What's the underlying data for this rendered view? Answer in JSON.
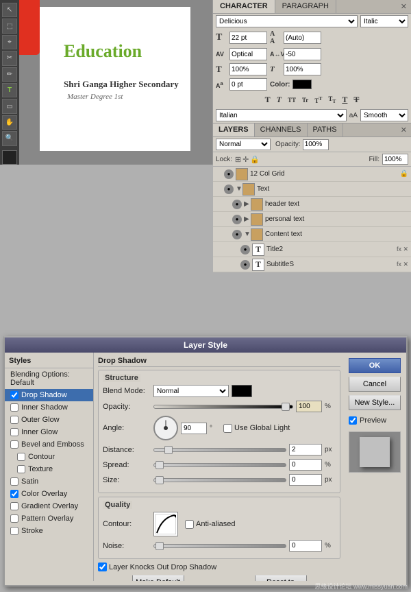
{
  "app": {
    "title": "Layer Style"
  },
  "character_panel": {
    "tabs": [
      "CHARACTER",
      "PARAGRAPH"
    ],
    "active_tab": "CHARACTER",
    "font_family": "Delicious",
    "font_style": "Italic",
    "font_size": "22 pt",
    "leading": "(Auto)",
    "kerning": "Optical",
    "tracking": "-50",
    "scale_v": "100%",
    "scale_h": "100%",
    "baseline": "0 pt",
    "color_label": "Color:",
    "language": "Italian",
    "anti_alias": "Smooth"
  },
  "layers_panel": {
    "tabs": [
      "LAYERS",
      "CHANNELS",
      "PATHS"
    ],
    "active_tab": "LAYERS",
    "blend_mode": "Normal",
    "opacity_label": "Opacity:",
    "opacity_value": "100%",
    "lock_label": "Lock:",
    "fill_label": "Fill:",
    "fill_value": "100%",
    "layers": [
      {
        "id": "grid",
        "name": "12 Col Grid",
        "type": "group",
        "indent": 1,
        "visible": true,
        "locked": true
      },
      {
        "id": "text",
        "name": "Text",
        "type": "group",
        "indent": 1,
        "visible": true
      },
      {
        "id": "header",
        "name": "header text",
        "type": "group",
        "indent": 2,
        "visible": true
      },
      {
        "id": "personal",
        "name": "personal text",
        "type": "group",
        "indent": 2,
        "visible": true
      },
      {
        "id": "content",
        "name": "Content text",
        "type": "group",
        "indent": 2,
        "visible": true
      },
      {
        "id": "title2",
        "name": "Title2",
        "type": "text",
        "indent": 3,
        "visible": true,
        "has_fx": true
      },
      {
        "id": "subtitle5",
        "name": "SubtitleS",
        "type": "text",
        "indent": 3,
        "visible": true,
        "has_fx": true
      }
    ]
  },
  "canvas": {
    "education_text": "Education",
    "school_text": "Shri Ganga Higher Secondary",
    "degree_text": "Master Degree 1st"
  },
  "layer_style_dialog": {
    "title": "Layer Style",
    "styles_header": "Styles",
    "styles": [
      {
        "id": "blending",
        "label": "Blending Options: Default",
        "type": "item"
      },
      {
        "id": "drop_shadow",
        "label": "Drop Shadow",
        "type": "checkbox",
        "checked": true,
        "selected": true
      },
      {
        "id": "inner_shadow",
        "label": "Inner Shadow",
        "type": "checkbox",
        "checked": false
      },
      {
        "id": "outer_glow",
        "label": "Outer Glow",
        "type": "checkbox",
        "checked": false
      },
      {
        "id": "inner_glow",
        "label": "Inner Glow",
        "type": "checkbox",
        "checked": false
      },
      {
        "id": "bevel",
        "label": "Bevel and Emboss",
        "type": "checkbox",
        "checked": false
      },
      {
        "id": "contour",
        "label": "Contour",
        "type": "checkbox",
        "checked": false,
        "sub": true
      },
      {
        "id": "texture",
        "label": "Texture",
        "type": "checkbox",
        "checked": false,
        "sub": true
      },
      {
        "id": "satin",
        "label": "Satin",
        "type": "checkbox",
        "checked": false
      },
      {
        "id": "color_overlay",
        "label": "Color Overlay",
        "type": "checkbox",
        "checked": true
      },
      {
        "id": "gradient_overlay",
        "label": "Gradient Overlay",
        "type": "checkbox",
        "checked": false
      },
      {
        "id": "pattern_overlay",
        "label": "Pattern Overlay",
        "type": "checkbox",
        "checked": false
      },
      {
        "id": "stroke",
        "label": "Stroke",
        "type": "checkbox",
        "checked": false
      }
    ],
    "section_title": "Drop Shadow",
    "structure_label": "Structure",
    "blend_mode_label": "Blend Mode:",
    "blend_mode_value": "Normal",
    "opacity_label": "Opacity:",
    "opacity_value": "100",
    "opacity_unit": "%",
    "angle_label": "Angle:",
    "angle_value": "90",
    "angle_unit": "°",
    "global_light_label": "Use Global Light",
    "distance_label": "Distance:",
    "distance_value": "2",
    "distance_unit": "px",
    "spread_label": "Spread:",
    "spread_value": "0",
    "spread_unit": "%",
    "size_label": "Size:",
    "size_value": "0",
    "size_unit": "px",
    "quality_label": "Quality",
    "contour_label": "Contour:",
    "anti_alias_label": "Anti-aliased",
    "noise_label": "Noise:",
    "noise_value": "0",
    "noise_unit": "%",
    "layer_knocks_label": "Layer Knocks Out Drop Shadow",
    "make_default_btn": "Make Default",
    "reset_default_btn": "Reset to Default",
    "ok_btn": "OK",
    "cancel_btn": "Cancel",
    "new_style_btn": "New Style...",
    "preview_label": "Preview"
  },
  "watermark": "思缘设计论坛 www.missyuan.com"
}
